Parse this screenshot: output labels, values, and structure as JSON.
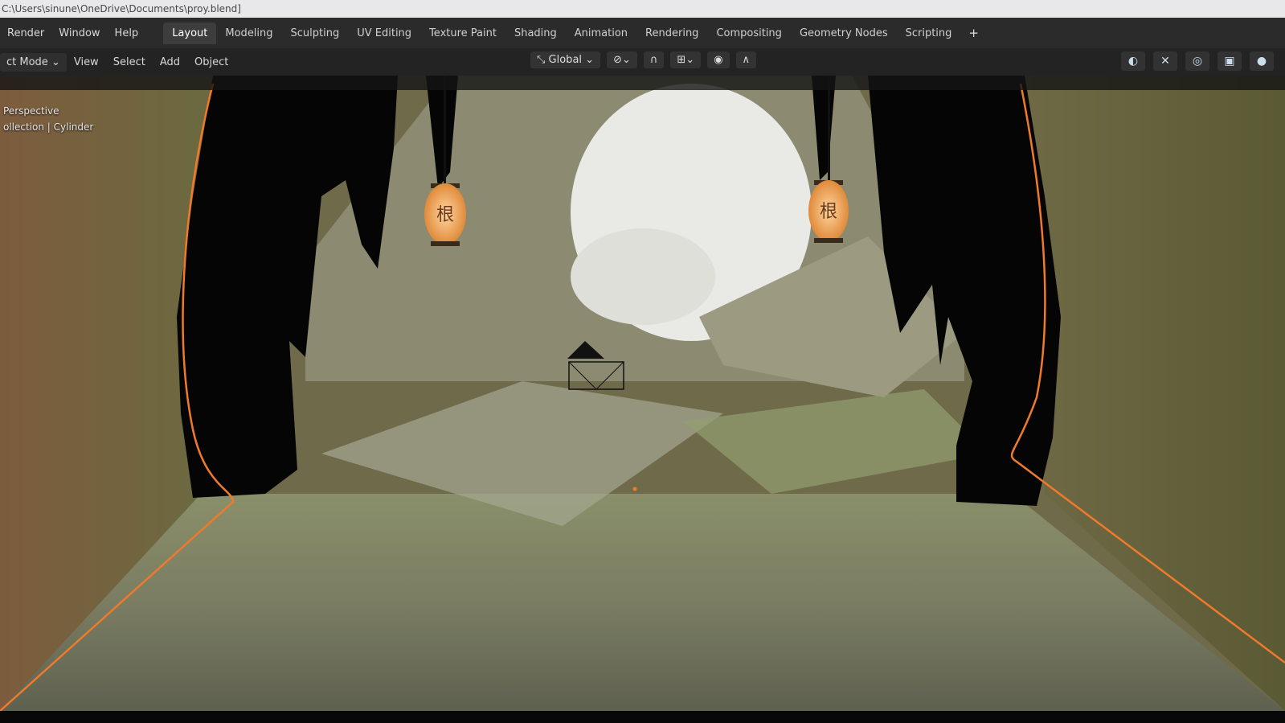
{
  "window": {
    "path": "C:\\Users\\sinune\\OneDrive\\Documents\\proy.blend]"
  },
  "menu": [
    "Render",
    "Window",
    "Help"
  ],
  "workspaces": [
    "Layout",
    "Modeling",
    "Sculpting",
    "UV Editing",
    "Texture Paint",
    "Shading",
    "Animation",
    "Rendering",
    "Compositing",
    "Geometry Nodes",
    "Scripting"
  ],
  "active_workspace": "Layout",
  "header": {
    "mode": "ct Mode",
    "items": [
      "View",
      "Select",
      "Add",
      "Object"
    ],
    "transform_orientation": "Global"
  },
  "viewport": {
    "view": "Perspective",
    "collection": "ollection | Cylinder",
    "lantern_glyph": "根"
  },
  "colors": {
    "accent_outline": "#f07a2a",
    "lantern": "#f5a95a"
  }
}
